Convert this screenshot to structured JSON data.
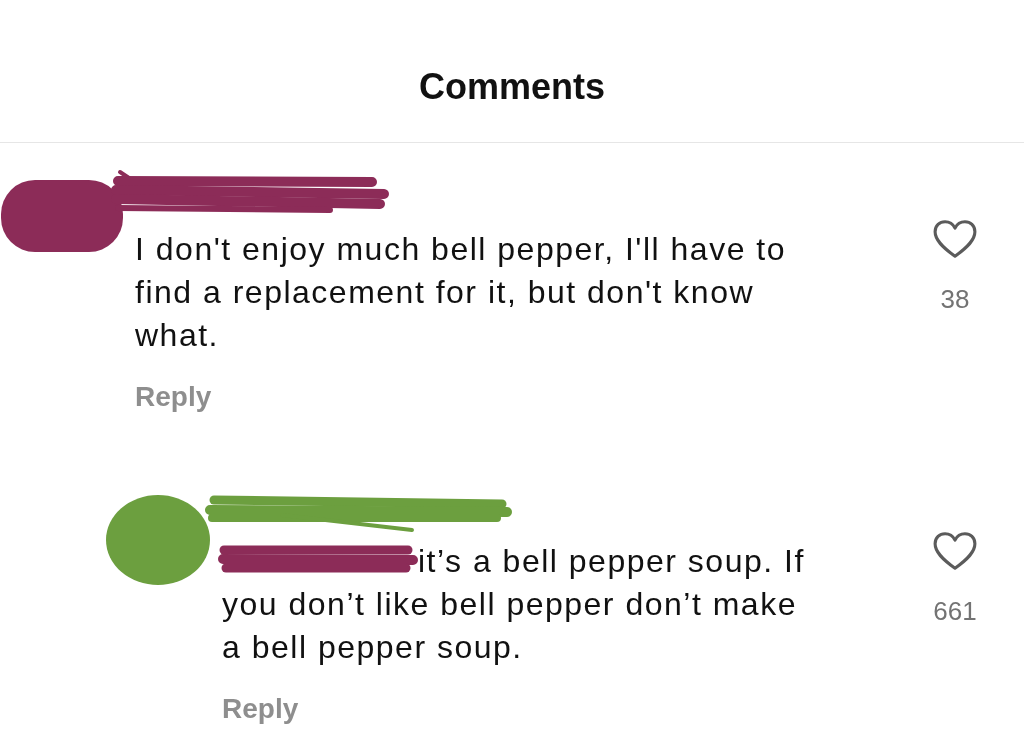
{
  "header": {
    "title": "Comments"
  },
  "comments": [
    {
      "kind": "comment",
      "color": "#8c2c58",
      "mention_hidden": false,
      "text": "I don't enjoy much bell pepper, I'll have to find a replacement for it, but don't know what.",
      "reply_label": "Reply",
      "liked": false,
      "like_count": "38"
    },
    {
      "kind": "reply",
      "color": "#6c9f3f",
      "mention_hidden": true,
      "text": "it’s a bell pepper soup. If you don’t like bell pepper don’t make a bell pepper soup.",
      "reply_label": "Reply",
      "liked": false,
      "like_count": "661"
    }
  ]
}
